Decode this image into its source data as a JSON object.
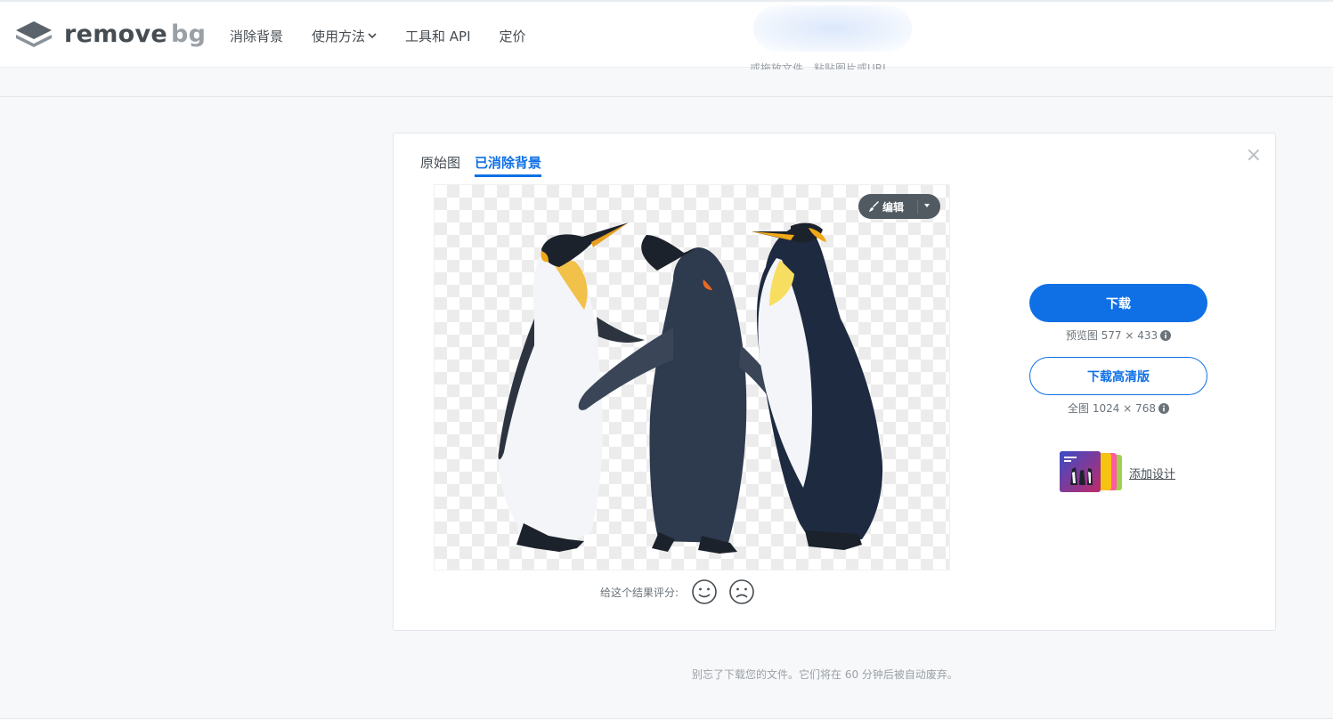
{
  "header": {
    "logo_text_1": "remove",
    "logo_text_2": "bg",
    "nav": [
      "消除背景",
      "使用方法",
      "工具和 API",
      "定价"
    ],
    "partial_text": "或拖放文件，粘贴图片或",
    "partial_link": "URL"
  },
  "card": {
    "tabs": [
      "原始图",
      "已消除背景"
    ],
    "active_tab": "已消除背景",
    "close_icon": "×",
    "edit_label": "编辑",
    "rating_label": "给这个结果评分:",
    "download_label": "下载",
    "preview_info": "预览图 577 × 433",
    "download_hd_label": "下载高清版",
    "full_info": "全图 1024 × 768",
    "add_design_label": "添加设计"
  },
  "footer_note": "别忘了下载您的文件。它们将在 60 分钟后被自动废弃。",
  "colors": {
    "accent": "#0f70e6",
    "text": "#454c52",
    "muted": "#9aa0a6",
    "edit_button": "#525a61"
  },
  "icons": [
    "logo-layers-icon",
    "chevron-down-icon",
    "close-icon",
    "brush-icon",
    "caret-down-icon",
    "smiley-icon",
    "frown-icon",
    "info-icon"
  ]
}
